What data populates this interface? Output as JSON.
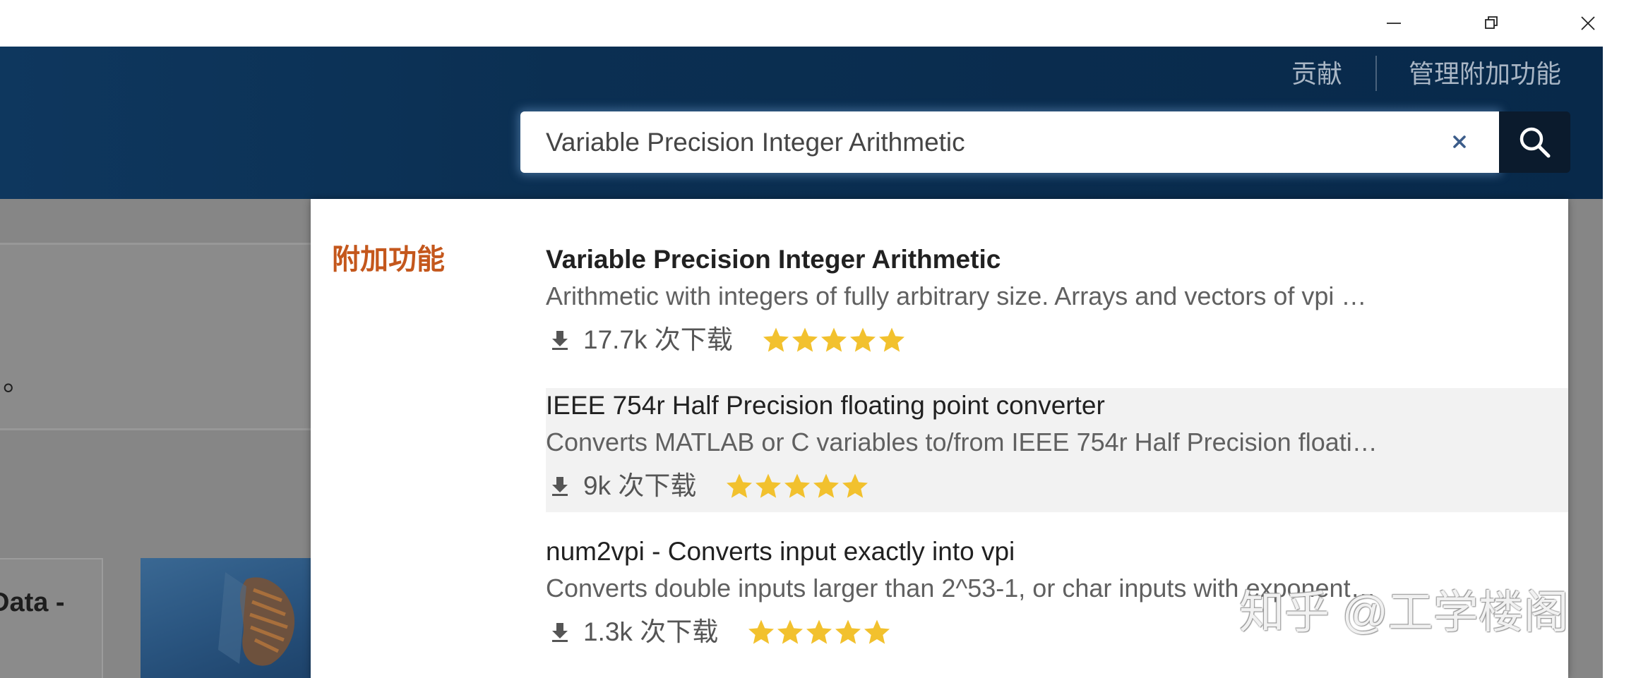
{
  "window": {
    "minimize_icon": "minimize-icon",
    "restore_icon": "restore-icon",
    "close_icon": "close-icon"
  },
  "header": {
    "links": [
      {
        "label": "贡献"
      },
      {
        "label": "管理附加功能"
      }
    ],
    "search": {
      "value": "Variable Precision Integer Arithmetic",
      "clear_icon": "clear-icon",
      "button_icon": "search-icon"
    }
  },
  "background_page": {
    "card_text": "。",
    "card_title": "Data -"
  },
  "results": {
    "section_label": "附加功能",
    "items": [
      {
        "title": "Variable Precision Integer Arithmetic",
        "description": "Arithmetic with integers of fully arbitrary size. Arrays and vectors of vpi …",
        "downloads": "17.7k 次下载",
        "rating": 5,
        "bold": true,
        "hovered": false
      },
      {
        "title": "IEEE 754r Half Precision floating point converter",
        "description": "Converts MATLAB or C variables to/from IEEE 754r Half Precision floati…",
        "downloads": "9k 次下载",
        "rating": 5,
        "bold": false,
        "hovered": true
      },
      {
        "title": "num2vpi - Converts input exactly into vpi",
        "description": "Converts double inputs larger than 2^53-1, or char inputs with exponent…",
        "downloads": "1.3k 次下载",
        "rating": 5,
        "bold": false,
        "hovered": false
      }
    ]
  },
  "watermark": "知乎 @工学楼阁",
  "colors": {
    "header_bg": "#0b2f52",
    "section_label": "#c4571c",
    "star": "#f2c12e",
    "hover_bg": "#f2f2f2"
  }
}
